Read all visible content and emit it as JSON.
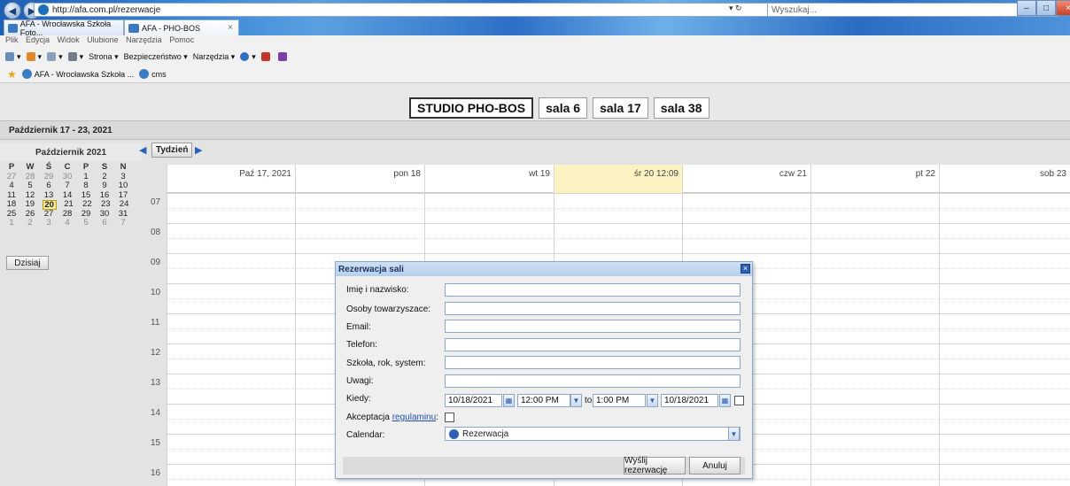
{
  "browser": {
    "url": "http://afa.com.pl/rezerwacje",
    "refresh_label": "▾ ↻",
    "search_placeholder": "Wyszukaj...",
    "tabs": [
      {
        "label": "AFA - Wrocławska Szkoła Foto..."
      },
      {
        "label": "AFA - PHO-BOS"
      }
    ],
    "menu": [
      "Plik",
      "Edycja",
      "Widok",
      "Ulubione",
      "Narzędzia",
      "Pomoc"
    ],
    "commands": [
      "Strona ▾",
      "Bezpieczeństwo ▾",
      "Narzędzia ▾"
    ],
    "favorites": [
      "AFA - Wrocławska Szkoła ...",
      "cms"
    ]
  },
  "studio_tabs": [
    "STUDIO PHO-BOS",
    "sala 6",
    "sala 17",
    "sala 38"
  ],
  "week_title": "Październik 17 - 23, 2021",
  "mini_calendar": {
    "title": "Październik 2021",
    "weekdays": [
      "P",
      "W",
      "Ś",
      "C",
      "P",
      "S",
      "N"
    ],
    "weeks": [
      [
        "27",
        "28",
        "29",
        "30",
        "1",
        "2",
        "3"
      ],
      [
        "4",
        "5",
        "6",
        "7",
        "8",
        "9",
        "10"
      ],
      [
        "11",
        "12",
        "13",
        "14",
        "15",
        "16",
        "17"
      ],
      [
        "18",
        "19",
        "20",
        "21",
        "22",
        "23",
        "24"
      ],
      [
        "25",
        "26",
        "27",
        "28",
        "29",
        "30",
        "31"
      ],
      [
        "1",
        "2",
        "3",
        "4",
        "5",
        "6",
        "7"
      ]
    ],
    "today_label": "Dzisiaj"
  },
  "toolbar": {
    "week_button": "Tydzień",
    "prev": "◀",
    "next": "▶"
  },
  "days": [
    "Paź 17, 2021",
    "pon 18",
    "wt 19",
    "śr 20 12:09",
    "czw 21",
    "pt 22",
    "sob 23"
  ],
  "hours": [
    "07",
    "08",
    "09",
    "10",
    "11",
    "12",
    "13",
    "14",
    "15",
    "16"
  ],
  "dialog": {
    "title": "Rezerwacja sali",
    "close": "×",
    "labels": {
      "name": "Imię i nazwisko:",
      "companions": "Osoby towarzyszace:",
      "email": "Email:",
      "phone": "Telefon:",
      "school": "Szkoła, rok, system:",
      "notes": "Uwagi:",
      "when": "Kiedy:",
      "accept_prefix": "Akceptacja ",
      "accept_link": "regulaminu",
      "accept_suffix": ":",
      "calendar": "Calendar:"
    },
    "start_date": "10/18/2021",
    "start_time": "12:00 PM",
    "to": "to",
    "end_time": "1:00 PM",
    "end_date": "10/18/2021",
    "calendar_value": "Rezerwacja",
    "submit": "Wyślij rezerwację",
    "cancel": "Anuluj"
  }
}
